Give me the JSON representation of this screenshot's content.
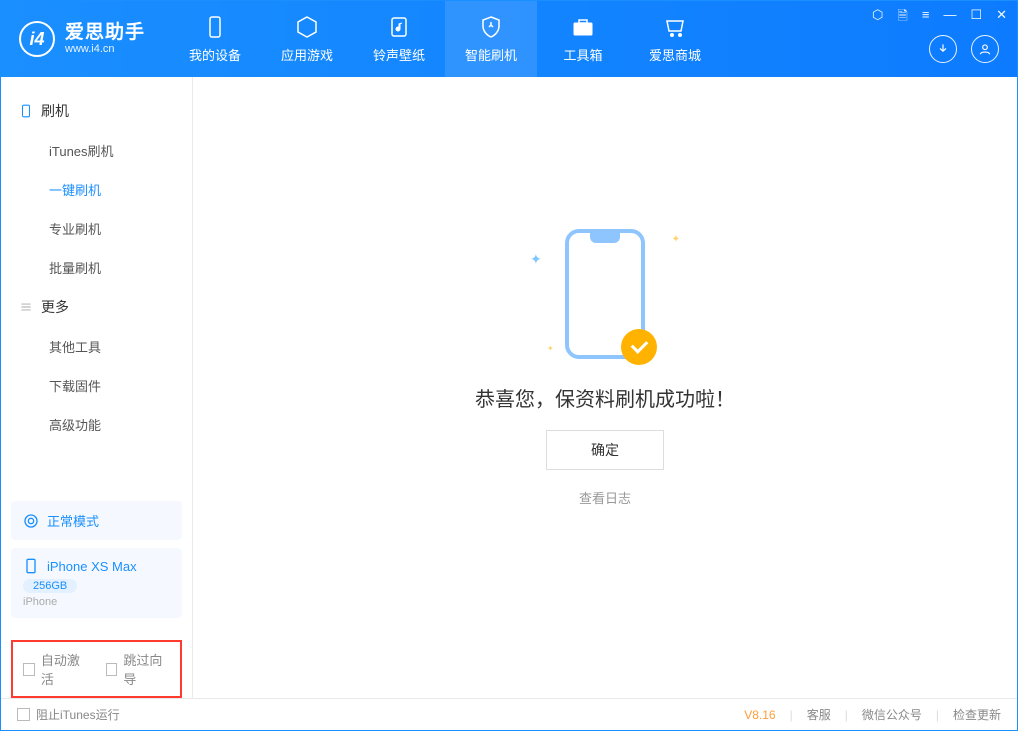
{
  "app": {
    "name": "爱思助手",
    "url": "www.i4.cn"
  },
  "nav": {
    "items": [
      {
        "label": "我的设备",
        "icon": "device"
      },
      {
        "label": "应用游戏",
        "icon": "cube"
      },
      {
        "label": "铃声壁纸",
        "icon": "music"
      },
      {
        "label": "智能刷机",
        "icon": "shield"
      },
      {
        "label": "工具箱",
        "icon": "toolbox"
      },
      {
        "label": "爱思商城",
        "icon": "cart"
      }
    ],
    "activeIndex": 3
  },
  "sidebar": {
    "sections": [
      {
        "title": "刷机",
        "items": [
          "iTunes刷机",
          "一键刷机",
          "专业刷机",
          "批量刷机"
        ],
        "activeIndex": 1
      },
      {
        "title": "更多",
        "items": [
          "其他工具",
          "下载固件",
          "高级功能"
        ]
      }
    ]
  },
  "devicePanel": {
    "modeLabel": "正常模式",
    "deviceName": "iPhone XS Max",
    "capacity": "256GB",
    "deviceType": "iPhone"
  },
  "options": {
    "autoActivateLabel": "自动激活",
    "skipGuideLabel": "跳过向导"
  },
  "main": {
    "successText": "恭喜您，保资料刷机成功啦！",
    "okLabel": "确定",
    "logLink": "查看日志"
  },
  "footer": {
    "blockItunesLabel": "阻止iTunes运行",
    "version": "V8.16",
    "links": [
      "客服",
      "微信公众号",
      "检查更新"
    ]
  }
}
